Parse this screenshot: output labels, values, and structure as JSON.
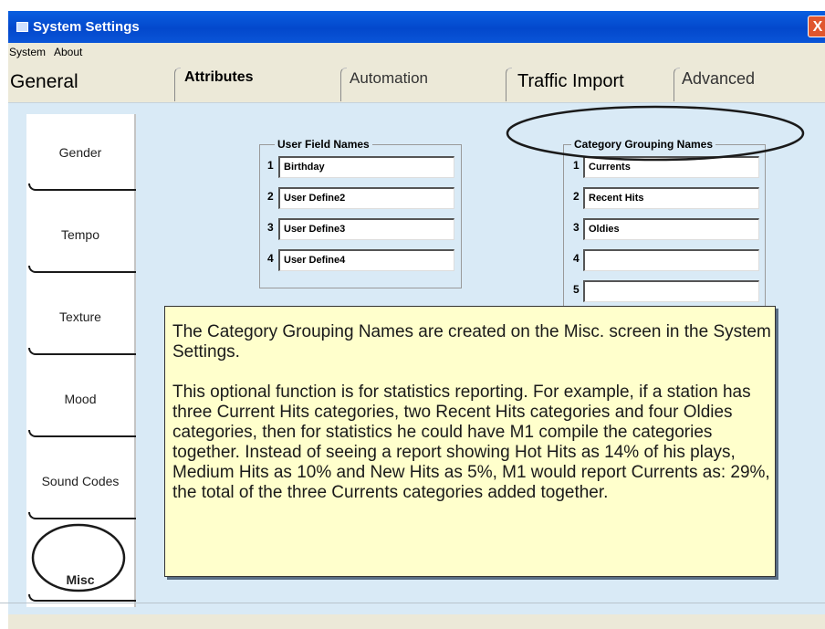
{
  "window": {
    "title": "System Settings",
    "close_label": "X"
  },
  "menu": {
    "items": [
      "System",
      "About"
    ]
  },
  "tabs": [
    "General",
    "Attributes",
    "Automation",
    "Traffic Import",
    "Advanced"
  ],
  "side_nav": [
    "Gender",
    "Tempo",
    "Texture",
    "Mood",
    "Sound Codes",
    "Misc"
  ],
  "user_fields": {
    "title": "User Field Names",
    "rows": [
      {
        "num": "1",
        "value": "Birthday"
      },
      {
        "num": "2",
        "value": "User Define2"
      },
      {
        "num": "3",
        "value": "User Define3"
      },
      {
        "num": "4",
        "value": "User Define4"
      }
    ]
  },
  "category_grouping": {
    "title": "Category Grouping Names",
    "rows": [
      {
        "num": "1",
        "value": "Currents"
      },
      {
        "num": "2",
        "value": "Recent Hits"
      },
      {
        "num": "3",
        "value": "Oldies"
      },
      {
        "num": "4",
        "value": ""
      },
      {
        "num": "5",
        "value": ""
      }
    ]
  },
  "callout": {
    "paragraph1": "The Category Grouping Names are created on the Misc. screen in the System Settings.",
    "paragraph2": "This optional function is for statistics reporting. For example, if a station has three Current Hits categories, two Recent Hits categories and four Oldies categories, then for statistics he could have M1 compile the categories together.  Instead of seeing a report showing Hot Hits as 14% of his plays, Medium Hits as 10% and New Hits as 5%, M1 would report Currents as: 29%, the total of the three Currents categories added together."
  },
  "colors": {
    "titlebar": "#0348cc",
    "panel": "#d9eaf6",
    "callout_bg": "#ffffcc",
    "annotation": "#1a1a1a"
  }
}
